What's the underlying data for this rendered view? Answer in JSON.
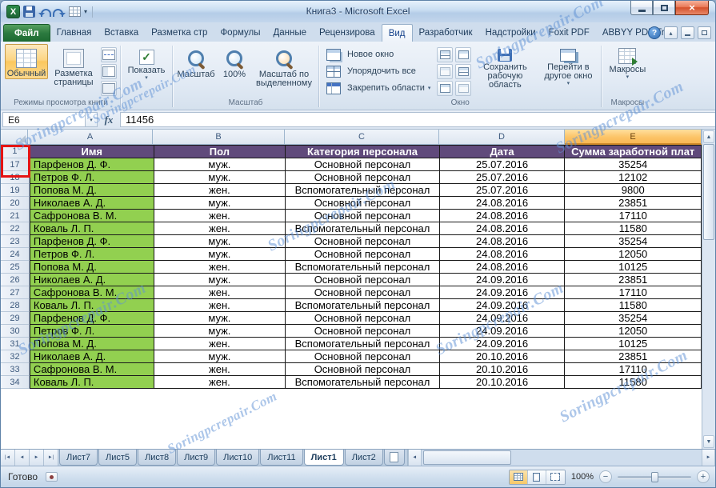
{
  "colors": {
    "header_purple": "#604a7b",
    "name_column_green": "#92d050",
    "selected_column_header": "#f9b854",
    "annotation_red": "#e51414",
    "file_tab_green": "#2c7a3f",
    "watermark_blue": "#6092d4"
  },
  "window": {
    "title": "Книга3  -  Microsoft Excel"
  },
  "icons": {
    "app": "X",
    "dropdown": "▾",
    "help": "?",
    "close": "×",
    "chevron_up": "▴",
    "scroll_up": "▲",
    "scroll_down": "▼",
    "nav_first": "|◄",
    "nav_prev": "◄",
    "nav_next": "►",
    "nav_last": "►|",
    "hscroll_left": "◄",
    "hscroll_right": "►",
    "zoom_out": "−",
    "zoom_in": "+",
    "check": "✓"
  },
  "ribbon": {
    "file_tab": "Файл",
    "tabs": [
      "Главная",
      "Вставка",
      "Разметка стр",
      "Формулы",
      "Данные",
      "Рецензирова",
      "Вид",
      "Разработчик",
      "Надстройки",
      "Foxit PDF",
      "ABBYY PDF Tra"
    ],
    "active_tab": "Вид",
    "view_group": {
      "label": "Режимы просмотра книги",
      "normal": "Обычный",
      "page_layout": "Разметка страницы"
    },
    "show_group": {
      "show": "Показать"
    },
    "zoom_group": {
      "label": "Масштаб",
      "zoom": "Масштаб",
      "hundred": "100%",
      "zoom_selection": "Масштаб по выделенному"
    },
    "window_group": {
      "label": "Окно",
      "new_window": "Новое окно",
      "arrange_all": "Упорядочить все",
      "freeze_panes": "Закрепить области",
      "save_workspace": "Сохранить рабочую область",
      "switch_windows": "Перейти в другое окно"
    },
    "macros_group": {
      "label": "Макросы",
      "macros": "Макросы"
    }
  },
  "formula_bar": {
    "name_box": "Е6",
    "fx": "fx",
    "value": "11456"
  },
  "sheet": {
    "columns": [
      "A",
      "B",
      "C",
      "D",
      "E"
    ],
    "selected_column": "E",
    "header_row": {
      "num": "1",
      "cells": [
        "Имя",
        "Пол",
        "Категория персонала",
        "Дата",
        "Сумма заработной плат"
      ]
    },
    "rows": [
      {
        "num": "17",
        "cells": [
          "Парфенов Д. Ф.",
          "муж.",
          "Основной персонал",
          "25.07.2016",
          "35254"
        ]
      },
      {
        "num": "18",
        "cells": [
          "Петров Ф. Л.",
          "муж.",
          "Основной персонал",
          "25.07.2016",
          "12102"
        ]
      },
      {
        "num": "19",
        "cells": [
          "Попова М. Д.",
          "жен.",
          "Вспомогательный персонал",
          "25.07.2016",
          "9800"
        ]
      },
      {
        "num": "20",
        "cells": [
          "Николаев А. Д.",
          "муж.",
          "Основной персонал",
          "24.08.2016",
          "23851"
        ]
      },
      {
        "num": "21",
        "cells": [
          "Сафронова В. М.",
          "жен.",
          "Основной персонал",
          "24.08.2016",
          "17110"
        ]
      },
      {
        "num": "22",
        "cells": [
          "Коваль Л. П.",
          "жен.",
          "Вспомогательный персонал",
          "24.08.2016",
          "11580"
        ]
      },
      {
        "num": "23",
        "cells": [
          "Парфенов Д. Ф.",
          "муж.",
          "Основной персонал",
          "24.08.2016",
          "35254"
        ]
      },
      {
        "num": "24",
        "cells": [
          "Петров Ф. Л.",
          "муж.",
          "Основной персонал",
          "24.08.2016",
          "12050"
        ]
      },
      {
        "num": "25",
        "cells": [
          "Попова М. Д.",
          "жен.",
          "Вспомогательный персонал",
          "24.08.2016",
          "10125"
        ]
      },
      {
        "num": "26",
        "cells": [
          "Николаев А. Д.",
          "муж.",
          "Основной персонал",
          "24.09.2016",
          "23851"
        ]
      },
      {
        "num": "27",
        "cells": [
          "Сафронова В. М.",
          "жен.",
          "Основной персонал",
          "24.09.2016",
          "17110"
        ]
      },
      {
        "num": "28",
        "cells": [
          "Коваль Л. П.",
          "жен.",
          "Вспомогательный персонал",
          "24.09.2016",
          "11580"
        ]
      },
      {
        "num": "29",
        "cells": [
          "Парфенов Д. Ф.",
          "муж.",
          "Основной персонал",
          "24.09.2016",
          "35254"
        ]
      },
      {
        "num": "30",
        "cells": [
          "Петров Ф. Л.",
          "муж.",
          "Основной персонал",
          "24.09.2016",
          "12050"
        ]
      },
      {
        "num": "31",
        "cells": [
          "Попова М. Д.",
          "жен.",
          "Вспомогательный персонал",
          "24.09.2016",
          "10125"
        ]
      },
      {
        "num": "32",
        "cells": [
          "Николаев А. Д.",
          "муж.",
          "Основной персонал",
          "20.10.2016",
          "23851"
        ]
      },
      {
        "num": "33",
        "cells": [
          "Сафронова В. М.",
          "жен.",
          "Основной персонал",
          "20.10.2016",
          "17110"
        ]
      },
      {
        "num": "34",
        "cells": [
          "Коваль Л. П.",
          "жен.",
          "Вспомогательный персонал",
          "20.10.2016",
          "11580"
        ]
      }
    ]
  },
  "sheet_tabs": {
    "tabs": [
      "Лист7",
      "Лист5",
      "Лист8",
      "Лист9",
      "Лист10",
      "Лист11",
      "Лист1",
      "Лист2"
    ],
    "active": "Лист1"
  },
  "status_bar": {
    "ready": "Готово",
    "zoom_level": "100%"
  },
  "watermark": {
    "text": "Soringpcrepair.Com"
  }
}
